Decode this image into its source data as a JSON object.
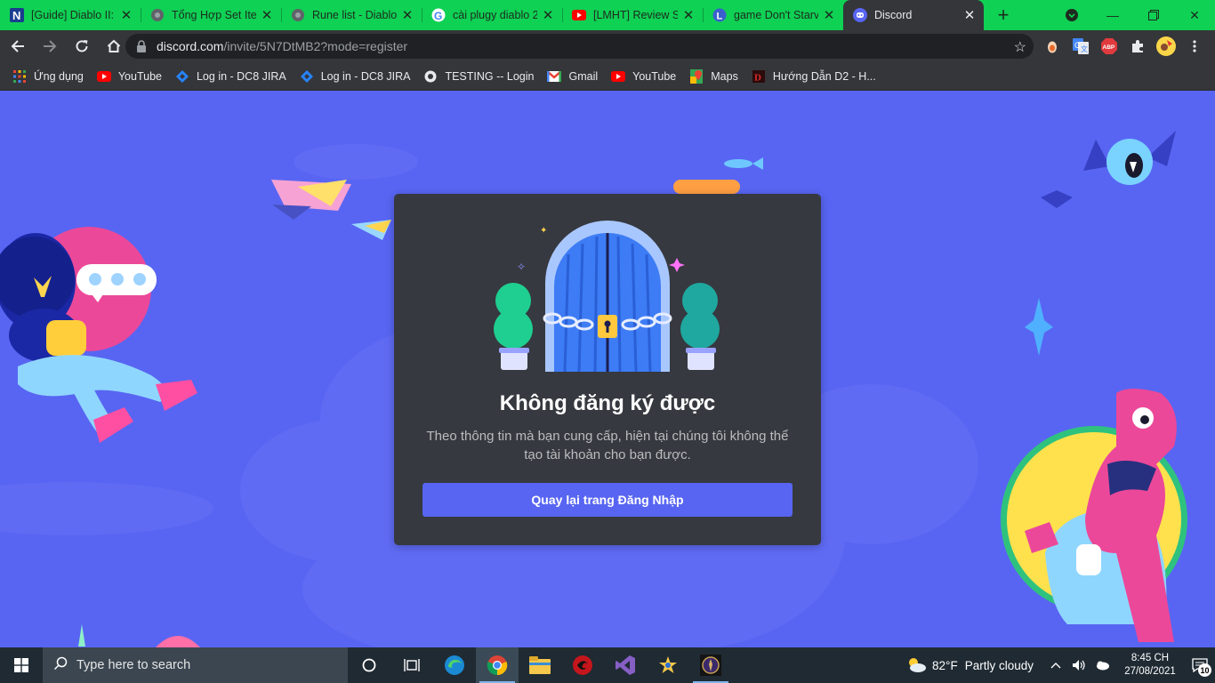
{
  "browser": {
    "tabs": [
      {
        "title": "[Guide] Diablo II: Resurrected",
        "favicon": "n-icon",
        "active": false
      },
      {
        "title": "Tổng Hợp Set Item",
        "favicon": "globe-icon",
        "active": false
      },
      {
        "title": "Rune list - Diablo",
        "favicon": "globe-icon",
        "active": false
      },
      {
        "title": "cài plugy diablo 2",
        "favicon": "google-icon",
        "active": false
      },
      {
        "title": "[LMHT] Review Sứ",
        "favicon": "youtube-icon",
        "active": false
      },
      {
        "title": "game Don't Starve",
        "favicon": "l-icon",
        "active": false
      },
      {
        "title": "Discord",
        "favicon": "discord-icon",
        "active": true
      }
    ],
    "url_host": "discord.com",
    "url_path": "/invite/5N7DtMB2?mode=register",
    "bookmarks": [
      {
        "label": "Ứng dụng",
        "icon": "apps-grid-icon"
      },
      {
        "label": "YouTube",
        "icon": "youtube-icon"
      },
      {
        "label": "Log in - DC8 JIRA",
        "icon": "jira-icon"
      },
      {
        "label": "Log in - DC8 JIRA",
        "icon": "jira-icon"
      },
      {
        "label": "TESTING -- Login",
        "icon": "globe-icon"
      },
      {
        "label": "Gmail",
        "icon": "gmail-icon"
      },
      {
        "label": "YouTube",
        "icon": "youtube-icon"
      },
      {
        "label": "Maps",
        "icon": "maps-icon"
      },
      {
        "label": "Hướng Dẫn D2 - H...",
        "icon": "d2-icon"
      }
    ]
  },
  "modal": {
    "title": "Không đăng ký được",
    "description": "Theo thông tin mà bạn cung cấp, hiện tại chúng tôi không thể tạo tài khoản cho bạn được.",
    "button_label": "Quay lại trang Đăng Nhập"
  },
  "taskbar": {
    "search_placeholder": "Type here to search",
    "weather_temp": "82°F",
    "weather_text": "Partly cloudy",
    "time": "8:45 CH",
    "date": "27/08/2021",
    "notification_count": "10"
  },
  "colors": {
    "tab_strip": "#0fd154",
    "discord_blurple": "#5865f2",
    "modal_bg": "#36393f",
    "taskbar": "#1f2a33"
  }
}
